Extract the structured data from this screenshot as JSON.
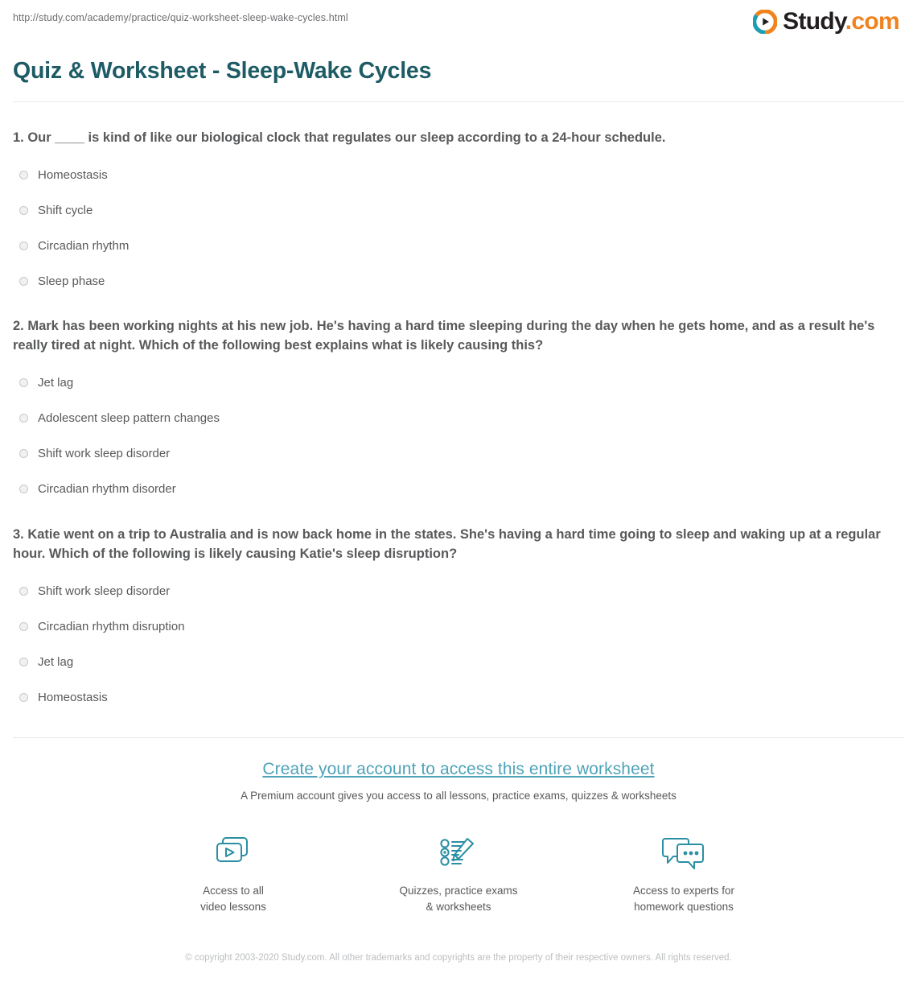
{
  "browser": {
    "url": "http://study.com/academy/practice/quiz-worksheet-sleep-wake-cycles.html"
  },
  "brand": {
    "name": "Study",
    "tld": ".com",
    "logo_icon": "play-circle-icon",
    "accent_orange": "#f0831e",
    "accent_teal": "#1d9cb3",
    "text_dark": "#231f20"
  },
  "page": {
    "title": "Quiz & Worksheet - Sleep-Wake Cycles",
    "title_color": "#1d5b65"
  },
  "questions": [
    {
      "text": "1. Our ____ is kind of like our biological clock that regulates our sleep according to a 24-hour schedule.",
      "options": [
        "Homeostasis",
        "Shift cycle",
        "Circadian rhythm",
        "Sleep phase"
      ]
    },
    {
      "text": "2. Mark has been working nights at his new job. He's having a hard time sleeping during the day when he gets home, and as a result he's really tired at night. Which of the following best explains what is likely causing this?",
      "options": [
        "Jet lag",
        "Adolescent sleep pattern changes",
        "Shift work sleep disorder",
        "Circadian rhythm disorder"
      ]
    },
    {
      "text": "3. Katie went on a trip to Australia and is now back home in the states. She's having a hard time going to sleep and waking up at a regular hour. Which of the following is likely causing Katie's sleep disruption?",
      "options": [
        "Shift work sleep disorder",
        "Circadian rhythm disruption",
        "Jet lag",
        "Homeostasis"
      ]
    }
  ],
  "cta": {
    "heading": "Create your account to access this entire worksheet",
    "heading_color": "#4fa3b8",
    "subheading": "A Premium account gives you access to all lessons, practice exams, quizzes & worksheets",
    "features": [
      {
        "icon": "video-lessons-icon",
        "line1": "Access to all",
        "line2": "video lessons"
      },
      {
        "icon": "quiz-checklist-pencil-icon",
        "line1": "Quizzes, practice exams",
        "line2": "& worksheets"
      },
      {
        "icon": "chat-bubbles-icon",
        "line1": "Access to experts for",
        "line2": "homework questions"
      }
    ]
  },
  "footer": {
    "copyright": "© copyright 2003-2020 Study.com. All other trademarks and copyrights are the property of their respective owners. All rights reserved."
  }
}
